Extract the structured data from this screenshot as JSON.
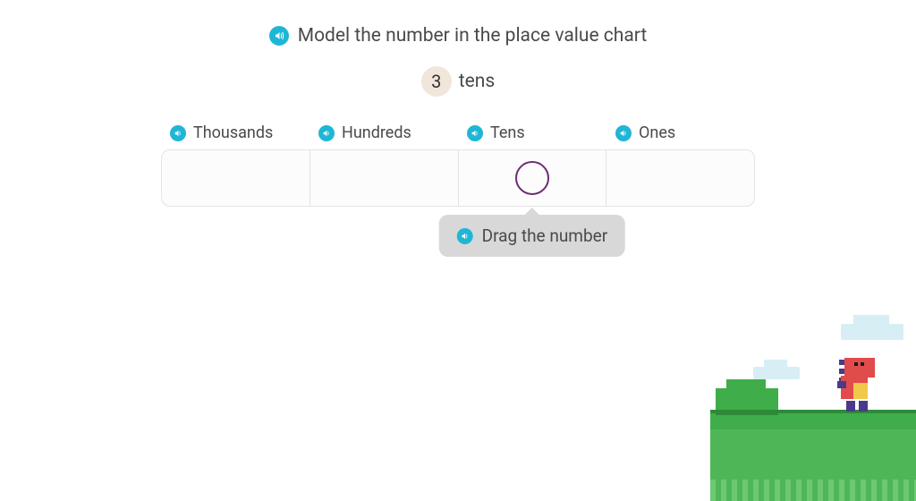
{
  "title": "Model the number in the place value chart",
  "prompt": {
    "digit": "3",
    "unit": "tens"
  },
  "columns": [
    {
      "label": "Thousands"
    },
    {
      "label": "Hundreds"
    },
    {
      "label": "Tens"
    },
    {
      "label": "Ones"
    }
  ],
  "hint": "Drag the number",
  "active_column_index": 2,
  "icons": {
    "audio": "audio-icon"
  }
}
